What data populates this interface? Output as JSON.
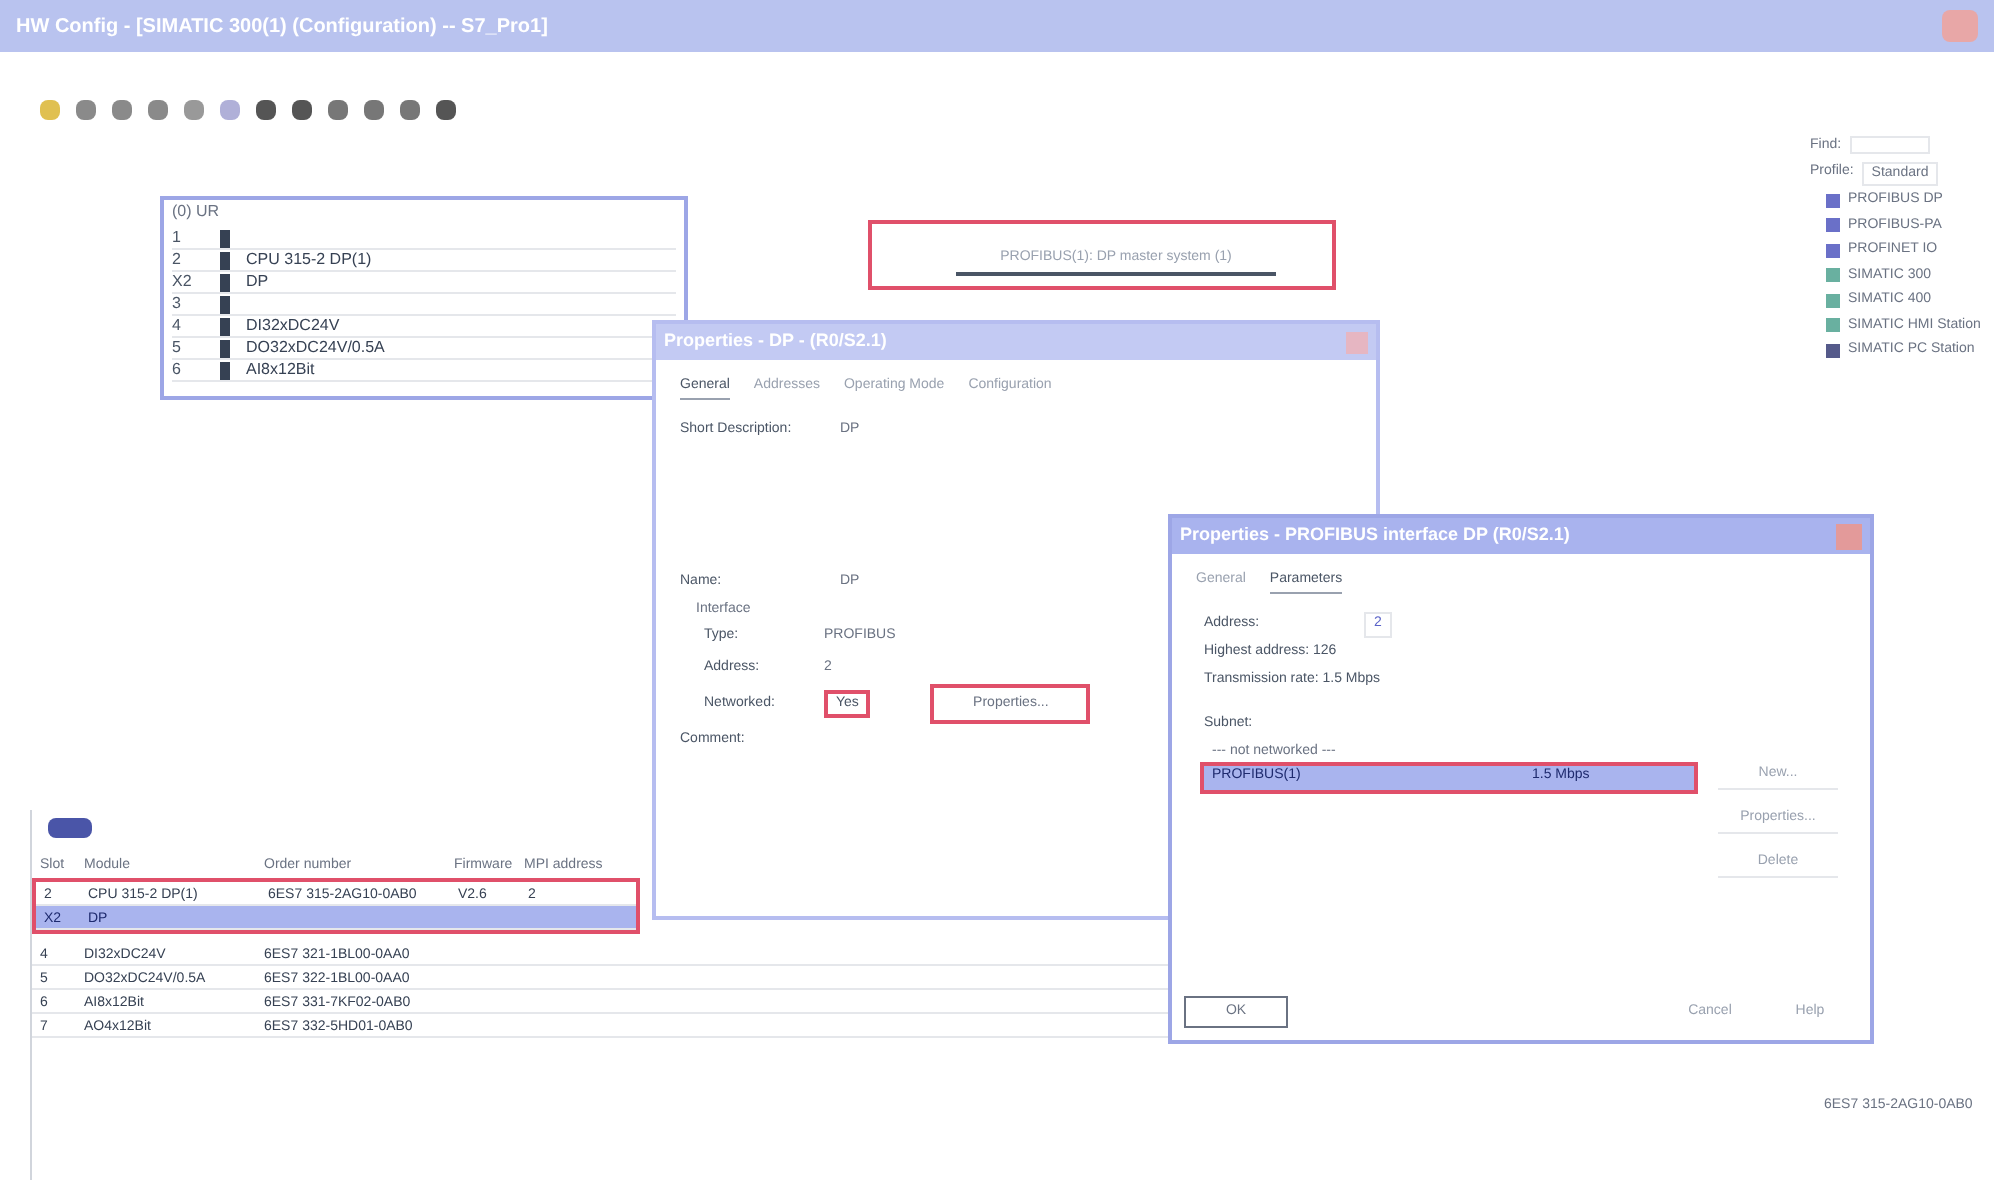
{
  "window": {
    "title": "HW Config - [SIMATIC 300(1) (Configuration) -- S7_Pro1]"
  },
  "rack": {
    "title": "(0) UR",
    "rows": [
      {
        "slot": "1",
        "module": ""
      },
      {
        "slot": "2",
        "module": "CPU 315-2 DP(1)"
      },
      {
        "slot": "X2",
        "module": "DP"
      },
      {
        "slot": "3",
        "module": ""
      },
      {
        "slot": "4",
        "module": "DI32xDC24V"
      },
      {
        "slot": "5",
        "module": "DO32xDC24V/0.5A"
      },
      {
        "slot": "6",
        "module": "AI8x12Bit"
      }
    ]
  },
  "network": {
    "label": "PROFIBUS(1): DP master system (1)"
  },
  "dialog_dp": {
    "title": "Properties - DP - (R0/S2.1)",
    "tabs": [
      {
        "label": "General",
        "selected": true
      },
      {
        "label": "Addresses",
        "selected": false
      },
      {
        "label": "Operating Mode",
        "selected": false
      },
      {
        "label": "Configuration",
        "selected": false
      }
    ],
    "short_description_label": "Short Description:",
    "short_description": "DP",
    "name_label": "Name:",
    "name": "DP",
    "interface_label": "Interface",
    "type_label": "Type:",
    "type": "PROFIBUS",
    "address_label": "Address:",
    "address": "2",
    "networked_label": "Networked:",
    "networked": "Yes",
    "properties_button": "Properties...",
    "comment_label": "Comment:"
  },
  "dialog_interface": {
    "title": "Properties - PROFIBUS interface DP (R0/S2.1)",
    "tabs": [
      {
        "label": "General",
        "selected": false
      },
      {
        "label": "Parameters",
        "selected": true
      }
    ],
    "address_label": "Address:",
    "address": "2",
    "highest_address": "Highest address: 126",
    "transmission_rate": "Transmission rate: 1.5 Mbps",
    "subnet_label": "Subnet:",
    "subnets": [
      {
        "name": "--- not networked ---",
        "selected": false
      },
      {
        "name": "PROFIBUS(1)",
        "rate": "1.5 Mbps",
        "selected": true
      }
    ],
    "side_buttons": [
      "New...",
      "Properties...",
      "Delete"
    ],
    "ok": "OK",
    "cancel": "Cancel",
    "help": "Help"
  },
  "detail_table": {
    "columns": [
      "Slot",
      "Module",
      "Order number",
      "Firmware",
      "MPI address"
    ],
    "rows": [
      {
        "cells": [
          "2",
          "CPU 315-2 DP(1)",
          "6ES7 315-2AG10-0AB0",
          "V2.6",
          "2"
        ],
        "selected": false
      },
      {
        "cells": [
          "X2",
          "DP",
          "",
          "",
          ""
        ],
        "selected": true
      },
      {
        "cells": [
          "4",
          "DI32xDC24V",
          "6ES7 321-1BL00-0AA0",
          "",
          ""
        ],
        "selected": false
      },
      {
        "cells": [
          "5",
          "DO32xDC24V/0.5A",
          "6ES7 322-1BL00-0AA0",
          "",
          ""
        ],
        "selected": false
      },
      {
        "cells": [
          "6",
          "AI8x12Bit",
          "6ES7 331-7KF02-0AB0",
          "",
          ""
        ],
        "selected": false
      },
      {
        "cells": [
          "7",
          "AO4x12Bit",
          "6ES7 332-5HD01-0AB0",
          "",
          ""
        ],
        "selected": false
      }
    ]
  },
  "catalog": {
    "find_label": "Find:",
    "profile_label": "Profile:",
    "profile": "Standard",
    "items": [
      "PROFIBUS DP",
      "PROFIBUS-PA",
      "PROFINET IO",
      "SIMATIC 300",
      "SIMATIC 400",
      "SIMATIC HMI Station",
      "SIMATIC PC Station"
    ],
    "footer": "6ES7 315-2AG10-0AB0"
  }
}
